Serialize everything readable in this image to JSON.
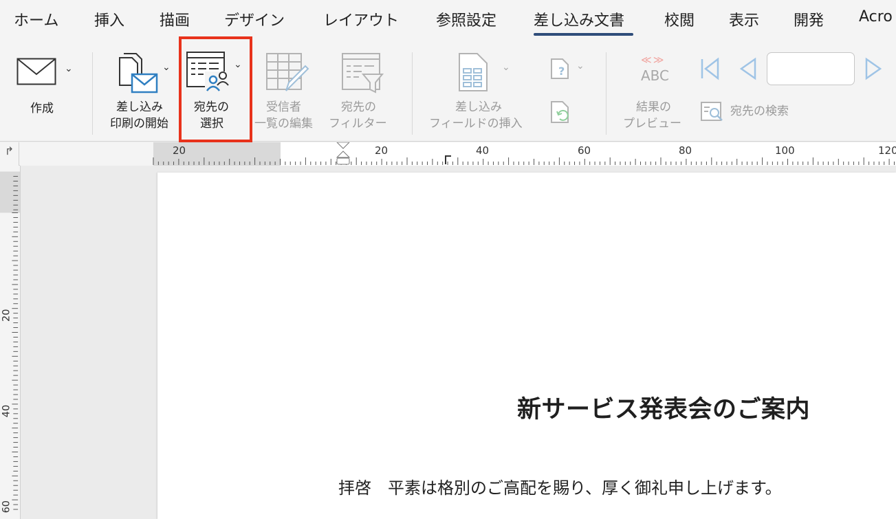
{
  "tabs": [
    {
      "label": "ホーム"
    },
    {
      "label": "挿入"
    },
    {
      "label": "描画"
    },
    {
      "label": "デザイン"
    },
    {
      "label": "レイアウト"
    },
    {
      "label": "参照設定"
    },
    {
      "label": "差し込み文書"
    },
    {
      "label": "校閲"
    },
    {
      "label": "表示"
    },
    {
      "label": "開発"
    },
    {
      "label": "Acro"
    }
  ],
  "active_tab": "差し込み文書",
  "ribbon": {
    "create": {
      "label": "作成",
      "icon": "envelope-icon"
    },
    "start_merge": {
      "label_line1": "差し込み",
      "label_line2": "印刷の開始",
      "icon": "documents-envelope-icon"
    },
    "select_recipients": {
      "label_line1": "宛先の",
      "label_line2": "選択",
      "icon": "recipient-list-icon"
    },
    "edit_recipients": {
      "label_line1": "受信者",
      "label_line2": "一覧の編集",
      "icon": "table-pencil-icon"
    },
    "filter_recipients": {
      "label_line1": "宛先の",
      "label_line2": "フィルター",
      "icon": "table-funnel-icon"
    },
    "insert_field": {
      "label_line1": "差し込み",
      "label_line2": "フィールドの挿入",
      "icon": "insert-field-icon"
    },
    "rules": {
      "icon": "rules-icon"
    },
    "update_labels": {
      "icon": "update-labels-icon"
    },
    "preview_results": {
      "label_line1": "結果の",
      "label_line2": "プレビュー",
      "icon_text": "ABC",
      "icon_mark": "≪≫"
    },
    "find_recipient": {
      "label": "宛先の検索",
      "icon": "find-recipient-icon"
    },
    "nav": {
      "first_icon": "first-record-icon",
      "prev_icon": "previous-record-icon",
      "next_icon": "next-record-icon",
      "record_value": ""
    }
  },
  "colors": {
    "highlight": "#e8321b",
    "tab_underline": "#2f4d7a",
    "icon_blue": "#2f7fc1",
    "disabled": "#a8a8a8"
  },
  "ruler": {
    "horizontal_labels": [
      "20",
      "20",
      "40",
      "60",
      "80",
      "100",
      "120"
    ],
    "vertical_labels": [
      "20",
      "40",
      "60"
    ]
  },
  "document": {
    "title": "新サービス発表会のご案内",
    "body": "拝啓　平素は格別のご高配を賜り、厚く御礼申し上げます。"
  }
}
